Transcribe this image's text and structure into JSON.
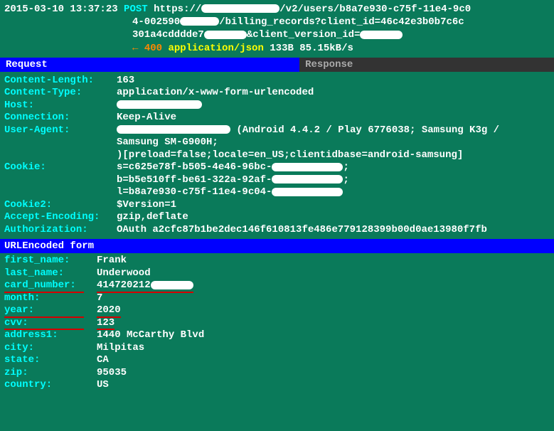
{
  "request": {
    "timestamp": "2015-03-10 13:37:23",
    "method": "POST",
    "url_l1": "https://             /v2/users/b8a7e930-c75f-11e4-9c0",
    "url_l2": "4-002590       /billing_records?client_id=46c42e3b0b7c6c",
    "url_l3": "301a4cdddde7        &client_version_id=",
    "resp_arrow": "←",
    "status": "400",
    "mime": "application/json",
    "resp_meta": "133B 85.15kB/s"
  },
  "tabs": {
    "request": "Request",
    "response": "Response"
  },
  "headers": {
    "content_length": {
      "k": "Content-Length:",
      "v": "163"
    },
    "content_type": {
      "k": "Content-Type:",
      "v": "application/x-www-form-urlencoded"
    },
    "host": {
      "k": "Host:",
      "v": ""
    },
    "connection": {
      "k": "Connection:",
      "v": "Keep-Alive"
    },
    "user_agent": {
      "k": "User-Agent:",
      "v1": " (Android 4.4.2 / Play 6776038; Samsung K3g /",
      "v2": "Samsung SM-G900H;",
      "v3": " )[preload=false;locale=en_US;clientidbase=android-samsung]"
    },
    "cookie": {
      "k": "Cookie:",
      "l1": "s=c625e78f-b505-4e46-96bc-            ;",
      "l2": "b=b5e510ff-be61-322a-92af-            ;",
      "l3": "l=b8a7e930-c75f-11e4-9c04-"
    },
    "cookie2": {
      "k": "Cookie2:",
      "v": "$Version=1"
    },
    "accept_encoding": {
      "k": "Accept-Encoding:",
      "v": "gzip,deflate"
    },
    "authorization": {
      "k": "Authorization:",
      "v": "OAuth a2cfc87b1be2dec146f610813fe486e779128399b00d0ae13980f7fb"
    }
  },
  "form_title": "URLEncoded form",
  "form": {
    "first_name": {
      "k": "first_name:",
      "v": "Frank"
    },
    "last_name": {
      "k": "last_name:",
      "v": "Underwood"
    },
    "card_number": {
      "k": "card_number:",
      "v": "414720212"
    },
    "month": {
      "k": "month:",
      "v": "7"
    },
    "year": {
      "k": "year:",
      "v": "2020"
    },
    "cvv": {
      "k": "cvv:",
      "v": "123"
    },
    "address1": {
      "k": "address1:",
      "v": "1440 McCarthy Blvd"
    },
    "city": {
      "k": "city:",
      "v": "Milpitas"
    },
    "state": {
      "k": "state:",
      "v": "CA"
    },
    "zip": {
      "k": "zip:",
      "v": "95035"
    },
    "country": {
      "k": "country:",
      "v": "US"
    }
  }
}
